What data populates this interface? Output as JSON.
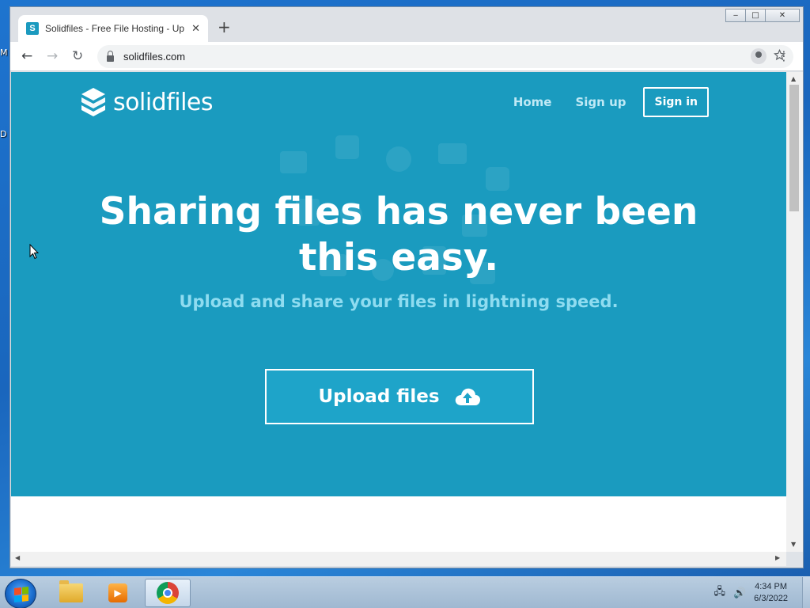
{
  "desktop": {
    "label_top": "M",
    "label_mid": "D"
  },
  "window": {
    "controls": {
      "minimize": "‒",
      "restore": "□",
      "close": "✕"
    }
  },
  "tab": {
    "favicon_letter": "S",
    "title": "Solidfiles - Free File Hosting - Up",
    "close": "✕",
    "new_tab": "+"
  },
  "toolbar": {
    "back": "←",
    "forward": "→",
    "reload": "↻",
    "url": "solidfiles.com",
    "share_icon": "share-icon",
    "bookmark_icon": "star-icon",
    "menu": "⋮"
  },
  "page": {
    "brand": "solidfiles",
    "nav": {
      "home": "Home",
      "signup": "Sign up",
      "signin": "Sign in"
    },
    "headline": "Sharing files has never been this easy.",
    "subline": "Upload and share your files in lightning speed.",
    "upload_label": "Upload files",
    "colors": {
      "hero_bg": "#1a9bbf",
      "subline": "#8fdcf0",
      "nav_link": "#bfe9f5"
    }
  },
  "taskbar": {
    "clock_time": "4:34 PM",
    "clock_date": "6/3/2022",
    "items": [
      "file-explorer",
      "media-player",
      "chrome"
    ],
    "active_item": "chrome"
  }
}
